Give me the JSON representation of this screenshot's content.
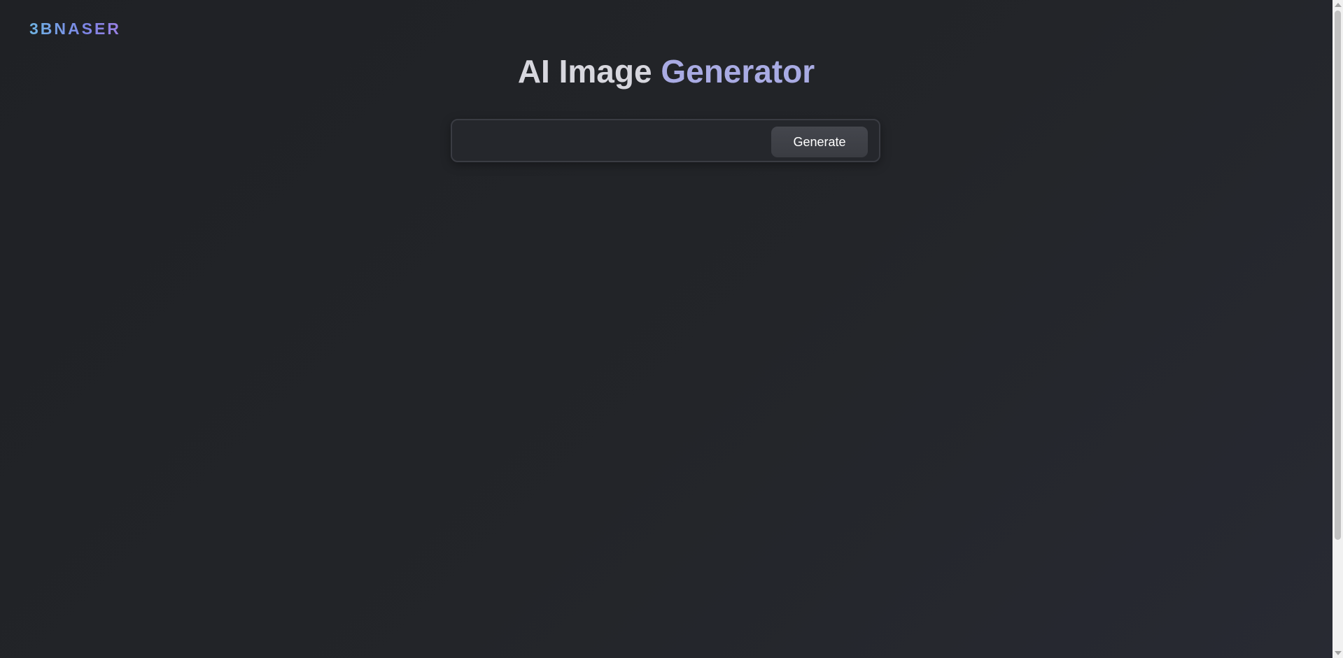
{
  "logo": {
    "text": "3BNASER"
  },
  "header": {
    "title_main": "AI Image",
    "title_accent": "Generator"
  },
  "prompt": {
    "value": "",
    "placeholder": ""
  },
  "actions": {
    "generate_label": "Generate"
  },
  "colors": {
    "background": "#232529",
    "title_main": "#d7d7de",
    "title_accent": "#a9abe3",
    "logo_gradient_start": "#6fb4e4",
    "logo_gradient_end": "#9a7fe2",
    "button_background": "#3f4147"
  }
}
